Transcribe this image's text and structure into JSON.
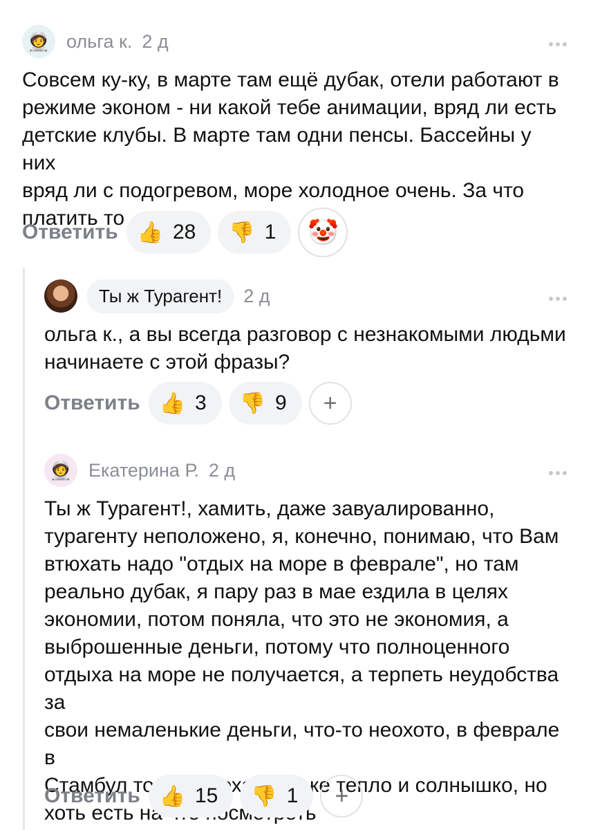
{
  "comments": [
    {
      "author": "ольга к.",
      "date": "2 д",
      "text": "Совсем ку-ку, в марте там ещё дубак, отели работают в\nрежиме эконом - ни какой  тебе анимации, вряд ли есть\nдетские клубы. В марте там одни пенсы. Бассейны у них\nвряд ли с подогревом, море холодное очень. За что\nплатить то",
      "reply_label": "Ответить",
      "likes": "28",
      "dislikes": "1",
      "extra_reaction": "🤡",
      "avatar_icon": "astronaut-icon"
    },
    {
      "author": "Ты ж Турагент!",
      "date": "2 д",
      "text": "ольга к., а вы всегда разговор с незнакомыми людьми\nначинаете с этой фразы?",
      "reply_label": "Ответить",
      "likes": "3",
      "dislikes": "9",
      "add_reaction": "+",
      "avatar_icon": "user-photo"
    },
    {
      "author": "Екатерина Р.",
      "date": "2 д",
      "text": "Ты ж Турагент!, хамить, даже завуалированно,\nтурагенту неположено, я, конечно, понимаю, что Вам\nвтюхать надо \"отдых на море в феврале\", но там\nреально дубак, я пару раз в мае ездила в целях\nэкономии, потом поняла, что это не экономия, а\nвыброшенные деньги, потому что полноценного\nотдыха на море не получается, а терпеть неудобства за\nсвои немаленькие деньги, что-то неохото, в феврале в\nСтамбул тогда уж ехать, тоже тепло и солнышко, но\nхоть есть на что посмотреть",
      "reply_label": "Ответить",
      "likes": "15",
      "dislikes": "1",
      "add_reaction": "+",
      "avatar_icon": "astronaut-icon"
    }
  ],
  "icons": {
    "like": "👍",
    "dislike": "👎",
    "astronaut": "🧑‍🚀"
  },
  "colors": {
    "muted_text": "#8a8e95",
    "chip_bg": "#f1f3f5",
    "thread_line": "#e3e5e8"
  }
}
